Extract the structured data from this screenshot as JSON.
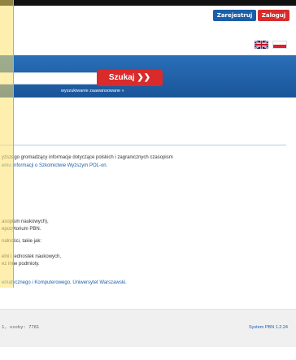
{
  "header": {
    "register_label": "Zarejestruj",
    "login_label": "Zaloguj"
  },
  "search": {
    "button_label": "Szukaj ❯❯",
    "advanced_link": "wyszukiwanie zaawansowane »"
  },
  "content": {
    "line1": "yższego gromadzący informacje dotyczące polskich i zagranicznych czasopism",
    "line2_link": "emu Informacji o Szkolnictwie Wyższym POL-on.",
    "line3": "asopism naukowych),",
    "line4": "epozytorium PBN.",
    "line5": "nalności, takie jak:",
    "line6": "elni i jednostek naukowych,",
    "line7": "ez inne podmioty.",
    "line8_link": "ematycznego i Komputerowego, Uniwersytet Warszawski."
  },
  "footer": {
    "left_text": "1, osoby: 7781",
    "version_link": "System PBN 1.2.24"
  },
  "colors": {
    "brand_blue": "#1a5fa8",
    "accent_red": "#d92b2b",
    "highlight_yellow": "#ffe16e"
  },
  "icons": {
    "lang_en": "uk-flag-icon",
    "lang_pl": "pl-flag-icon"
  }
}
